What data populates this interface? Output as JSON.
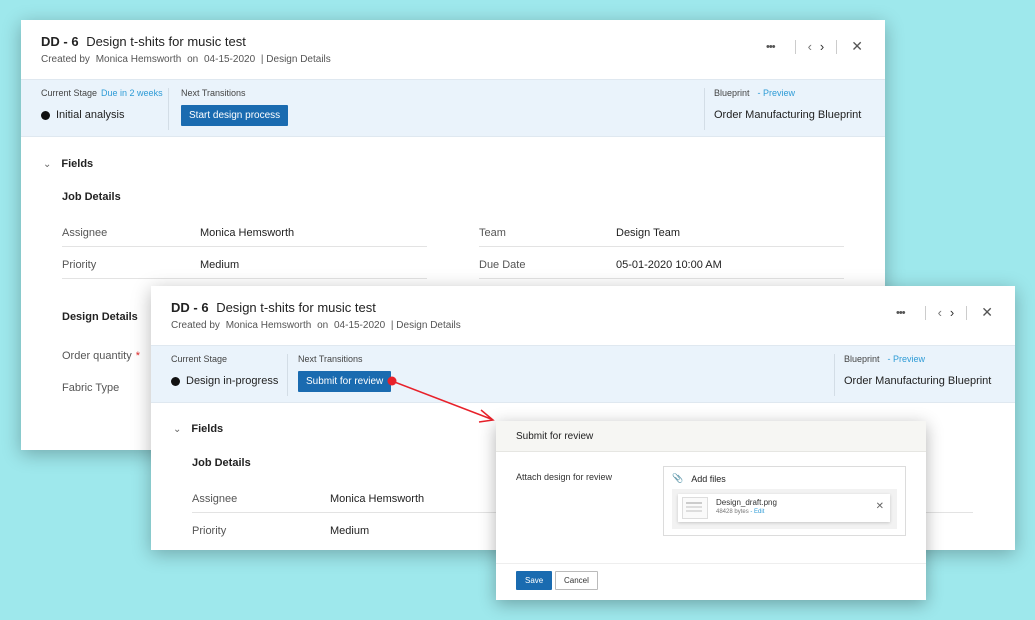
{
  "colors": {
    "background": "#9ee8ec",
    "accent": "#1a6bb0",
    "link": "#2e9bd6",
    "stage_bar": "#eaf3fb",
    "arrow": "#e8212a"
  },
  "back_card": {
    "id": "DD - 6",
    "title": "Design t-shits for music test",
    "created_by_label": "Created by",
    "created_by": "Monica Hemsworth",
    "on_label": "on",
    "date": "04-15-2020",
    "module": "| Design Details",
    "current_stage_label": "Current Stage",
    "due": "Due in 2 weeks",
    "current_stage": "Initial analysis",
    "next_transitions_label": "Next Transitions",
    "transition_button": "Start design process",
    "blueprint_label": "Blueprint",
    "preview": "- Preview",
    "blueprint": "Order Manufacturing Blueprint",
    "fields_label": "Fields",
    "job_details_label": "Job Details",
    "fields": [
      {
        "key": "Assignee",
        "value": "Monica Hemsworth"
      },
      {
        "key": "Priority",
        "value": "Medium"
      },
      {
        "key": "Team",
        "value": "Design Team"
      },
      {
        "key": "Due Date",
        "value": "05-01-2020 10:00 AM"
      }
    ],
    "design_details_label": "Design Details",
    "design_fields": [
      {
        "key": "Order quantity",
        "required": "*"
      },
      {
        "key": "Fabric Type"
      }
    ]
  },
  "front_card": {
    "id": "DD - 6",
    "title": "Design t-shits for music test",
    "created_by_label": "Created by",
    "created_by": "Monica Hemsworth",
    "on_label": "on",
    "date": "04-15-2020",
    "module": "| Design Details",
    "current_stage_label": "Current Stage",
    "current_stage": "Design in-progress",
    "next_transitions_label": "Next Transitions",
    "transition_button": "Submit for review",
    "blueprint_label": "Blueprint",
    "preview": "- Preview",
    "blueprint": "Order Manufacturing Blueprint",
    "fields_label": "Fields",
    "job_details_label": "Job Details",
    "fields": [
      {
        "key": "Assignee",
        "value": "Monica Hemsworth"
      },
      {
        "key": "Priority",
        "value": "Medium"
      }
    ]
  },
  "dialog": {
    "title": "Submit for review",
    "attach_label": "Attach design for review",
    "add_files": "Add files",
    "file_name": "Design_draft.png",
    "file_size": "48428 bytes",
    "file_edit": "- Edit",
    "save": "Save",
    "cancel": "Cancel"
  },
  "icons": {
    "more": "more-horizontal-icon",
    "prev": "chevron-left-icon",
    "next": "chevron-right-icon",
    "close": "close-icon",
    "collapse": "chevron-down-icon",
    "attach": "paperclip-icon",
    "stage": "stage-dot-icon"
  }
}
